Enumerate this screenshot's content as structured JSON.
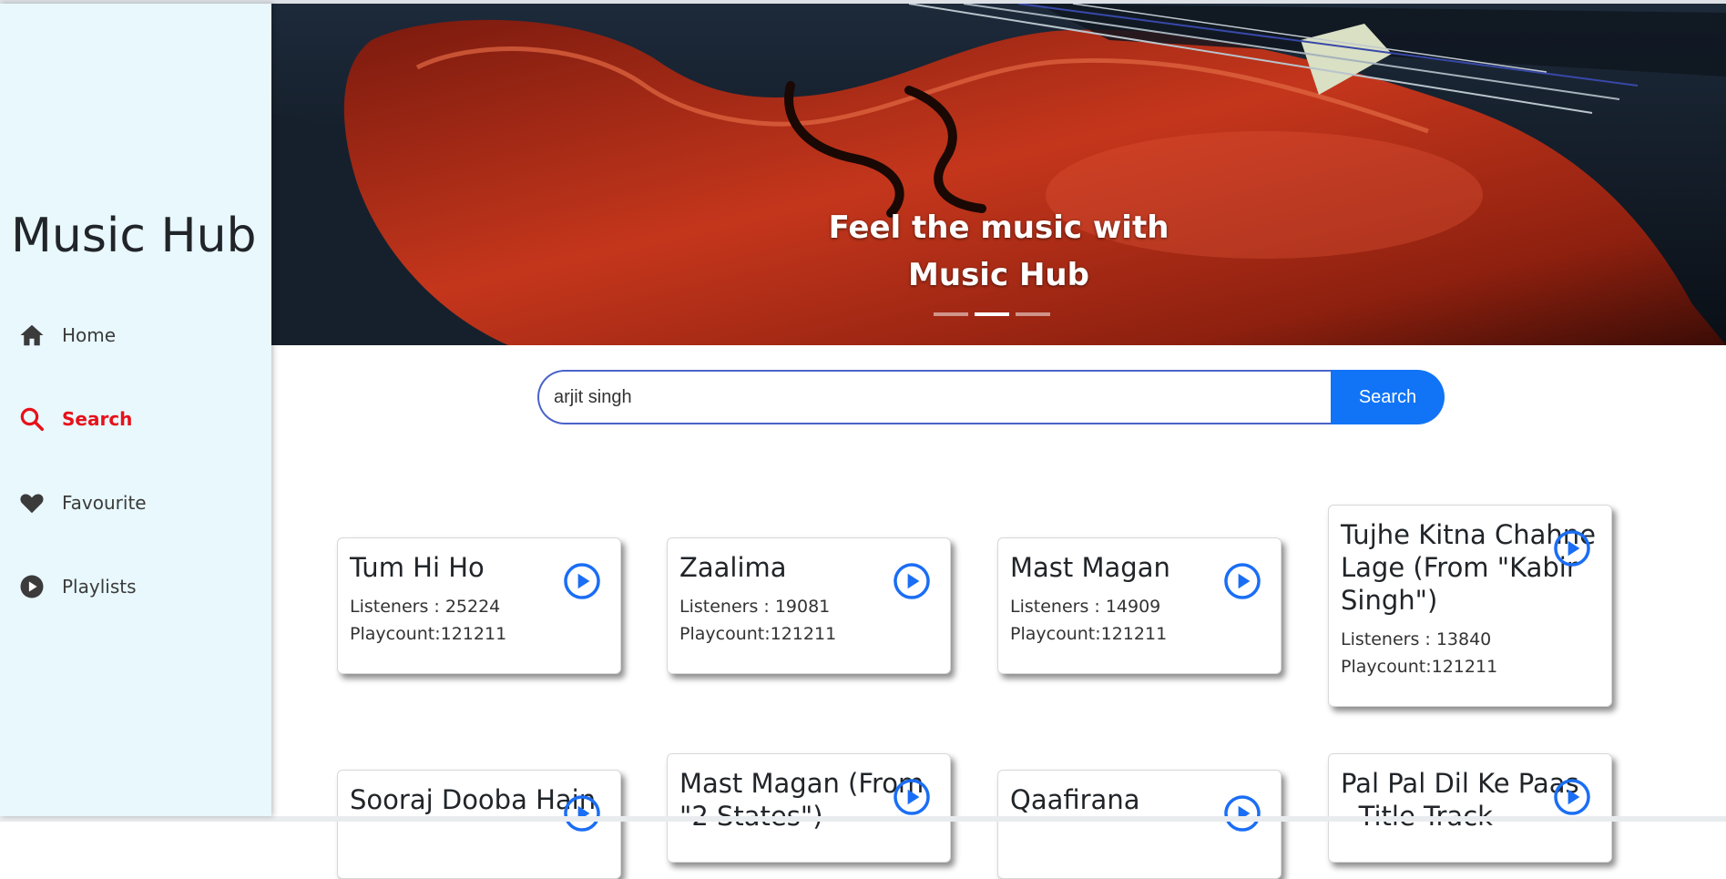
{
  "sidebar": {
    "brand": "Music Hub",
    "items": [
      {
        "label": "Home",
        "icon": "home-icon"
      },
      {
        "label": "Search",
        "icon": "search-icon",
        "active": true
      },
      {
        "label": "Favourite",
        "icon": "heart-icon"
      },
      {
        "label": "Playlists",
        "icon": "play-circle-icon"
      }
    ]
  },
  "banner": {
    "caption_line1": "Feel the music with",
    "caption_line2": "Music Hub",
    "active_slide": 2,
    "slide_count": 3
  },
  "search": {
    "value": "arjit singh",
    "button_label": "Search"
  },
  "colors": {
    "sidebar_bg": "#e8f8fd",
    "accent_active": "#e8101a",
    "primary": "#1174f6",
    "play_icon": "#1a6ef5"
  },
  "cards": [
    {
      "title": "Tum Hi Ho",
      "listeners": "Listeners : 25224",
      "playcount": "Playcount:121211"
    },
    {
      "title": "Zaalima",
      "listeners": "Listeners : 19081",
      "playcount": "Playcount:121211"
    },
    {
      "title": "Mast Magan",
      "listeners": "Listeners : 14909",
      "playcount": "Playcount:121211"
    },
    {
      "title": "Tujhe Kitna Chahne Lage (From \"Kabir Singh\")",
      "listeners": "Listeners : 13840",
      "playcount": "Playcount:121211"
    },
    {
      "title": "Sooraj Dooba Hain"
    },
    {
      "title": "Mast Magan (From \"2 States\")"
    },
    {
      "title": "Qaafirana"
    },
    {
      "title": "Pal Pal Dil Ke Paas - Title Track"
    }
  ]
}
